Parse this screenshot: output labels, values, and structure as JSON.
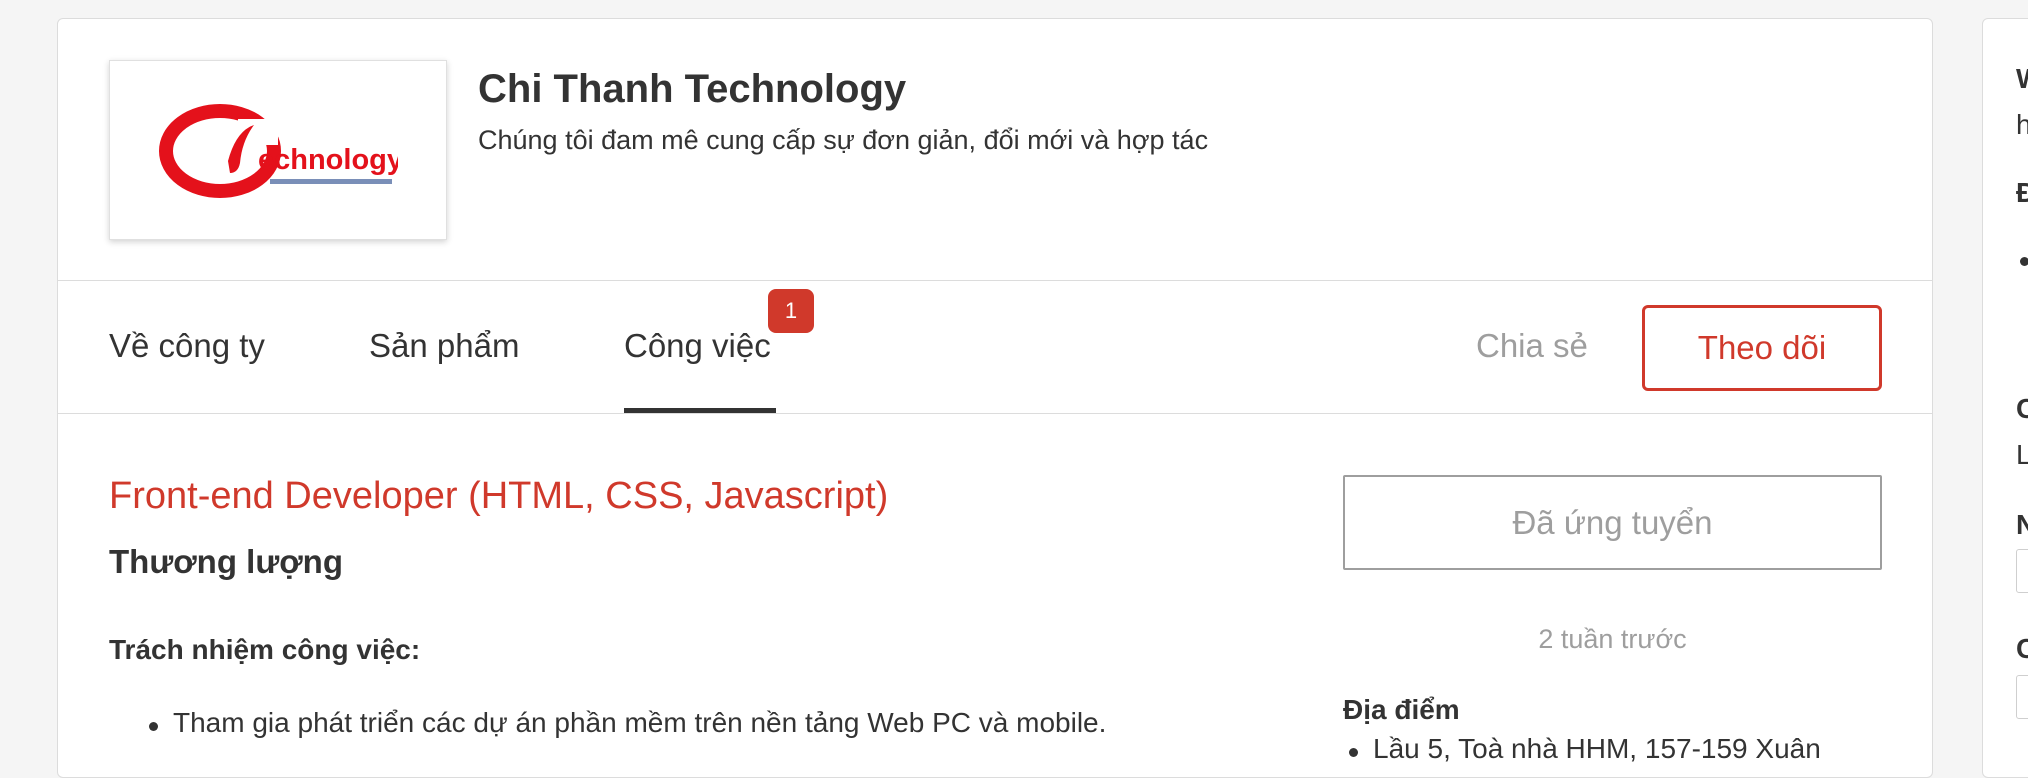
{
  "company": {
    "name": "Chi Thanh Technology",
    "tagline": "Chúng tôi đam mê cung cấp sự đơn giản, đổi mới và hợp tác",
    "logo_text": "echnology"
  },
  "tabs": [
    {
      "label": "Về công ty"
    },
    {
      "label": "Sản phẩm"
    },
    {
      "label": "Công việc",
      "badge": "1",
      "active": true
    }
  ],
  "actions": {
    "share_label": "Chia sẻ",
    "follow_label": "Theo dõi"
  },
  "job": {
    "title": "Front-end Developer (HTML, CSS, Javascript)",
    "salary": "Thương lượng",
    "responsibilities_heading": "Trách nhiệm công việc:",
    "responsibilities": [
      "Tham gia phát triển các dự án phần mềm trên nền tảng Web PC và mobile."
    ],
    "applied_label": "Đã ứng tuyển",
    "posted": "2 tuần trước",
    "location_heading": "Địa điểm",
    "locations": [
      "Lầu 5, Toà nhà HHM, 157-159 Xuân"
    ]
  },
  "sidebar": {
    "line1": "W",
    "line2": "h",
    "line3": "Đ",
    "line4": "C",
    "line5": "L",
    "line6": "N",
    "line7": "C"
  },
  "colors": {
    "accent": "#d0392b",
    "muted": "#9e9e9e",
    "text": "#333333",
    "border": "#dcdcdc"
  }
}
